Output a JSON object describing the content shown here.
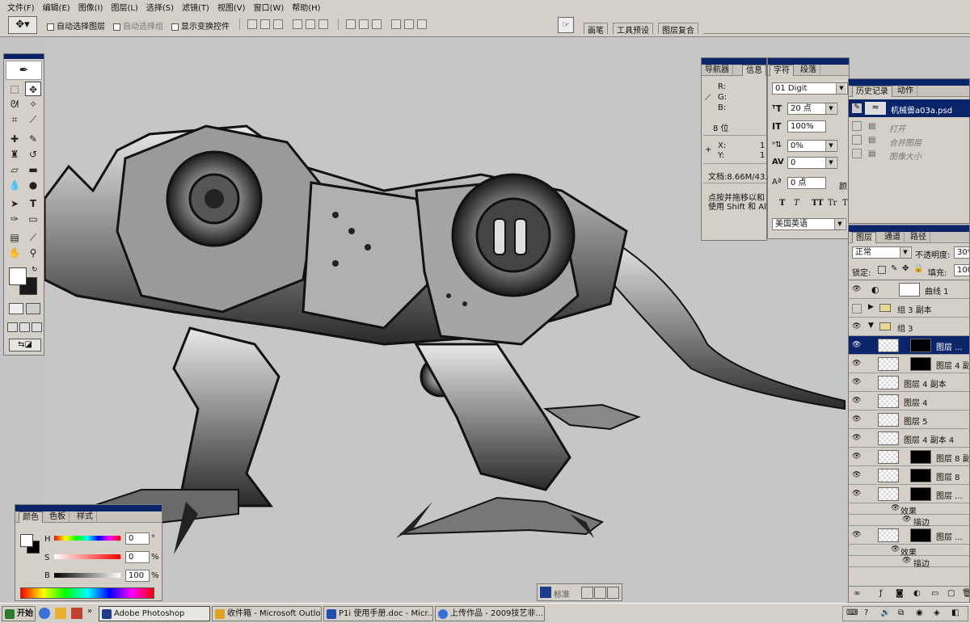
{
  "menubar": {
    "items": [
      "文件(F)",
      "编辑(E)",
      "图像(I)",
      "图层(L)",
      "选择(S)",
      "滤镜(T)",
      "视图(V)",
      "窗口(W)",
      "帮助(H)"
    ]
  },
  "options": {
    "auto_select_layer": "自动选择图层",
    "auto_select_group": "自动选择组",
    "show_transform": "显示变换控件",
    "wells": [
      "画笔",
      "工具预设",
      "图层复合"
    ]
  },
  "navigator": {
    "tabs": [
      "导航器",
      "信息"
    ],
    "r": "R:",
    "g": "G:",
    "b": "B:",
    "bit": "8 位",
    "x": "X:",
    "y": "Y:",
    "x_val": "1",
    "y_val": "1",
    "doc": "文档:8.66M/43.7",
    "hint1": "点按并拖移以和",
    "hint2": "使用 Shift 和 Alt"
  },
  "character": {
    "tabs": [
      "字符",
      "段落"
    ],
    "font": "01 Digit",
    "size": "20 点",
    "vscale": "100%",
    "tracking_shift": "0%",
    "kerning": "0",
    "baseline": "0 点",
    "color_label": "颜",
    "style_buttons": [
      "T",
      "T",
      "TT",
      "Tr",
      "T"
    ],
    "language": "美国英语"
  },
  "history": {
    "tabs": [
      "历史记录",
      "动作"
    ],
    "snapshot": "机械兽a03a.psd",
    "steps": [
      "打开",
      "合并图层",
      "图像大小"
    ]
  },
  "layers": {
    "tabs": [
      "图层",
      "通道",
      "路径"
    ],
    "blend_mode": "正常",
    "opacity_label": "不透明度:",
    "opacity": "30%",
    "lock_label": "锁定:",
    "fill_label": "填充:",
    "fill": "100%",
    "rows": [
      {
        "name": "曲线 1",
        "type": "adjust",
        "eye": true
      },
      {
        "name": "组 3 副本",
        "type": "group-closed",
        "eye": false
      },
      {
        "name": "组 3",
        "type": "group-open",
        "eye": true
      },
      {
        "name": "图层 ...",
        "type": "mask",
        "eye": true,
        "selected": true
      },
      {
        "name": "图层 4 副",
        "type": "mask",
        "eye": true
      },
      {
        "name": "图层 4 副本",
        "type": "plain",
        "eye": true
      },
      {
        "name": "图层 4",
        "type": "plain",
        "eye": true
      },
      {
        "name": "图层 5",
        "type": "plain",
        "eye": true
      },
      {
        "name": "图层 4 副本 4",
        "type": "plain",
        "eye": true
      },
      {
        "name": "图层 8 副",
        "type": "mask",
        "eye": true
      },
      {
        "name": "图层 8",
        "type": "mask",
        "eye": true
      },
      {
        "name": "图层 ...",
        "type": "mask",
        "eye": true
      },
      {
        "name": "效果",
        "type": "fx",
        "eye": false
      },
      {
        "name": "描边",
        "type": "fx-sub",
        "eye": false
      },
      {
        "name": "图层 ...",
        "type": "mask",
        "eye": true
      },
      {
        "name": "效果",
        "type": "fx",
        "eye": false
      },
      {
        "name": "描边",
        "type": "fx-sub",
        "eye": false
      }
    ]
  },
  "color_panel": {
    "tabs": [
      "颜色",
      "色板",
      "样式"
    ],
    "h_label": "H",
    "s_label": "S",
    "b_label": "B",
    "h": "0",
    "s": "0",
    "b": "100",
    "h_unit": "°",
    "s_unit": "%",
    "b_unit": "%"
  },
  "mode_bar": {
    "label": "标准"
  },
  "taskbar": {
    "start": "开始",
    "tasks": [
      "Adobe Photoshop",
      "收件箱 - Microsoft Outlook",
      "P1i 使用手册.doc - Micr...",
      "上传作品 - 2009技艺非..."
    ]
  },
  "colors": {
    "titlebar": "#0a246a",
    "selected_row": "#0a246a",
    "panel_bg": "#d4d0c8",
    "canvas_bg": "#c6c6c6"
  }
}
